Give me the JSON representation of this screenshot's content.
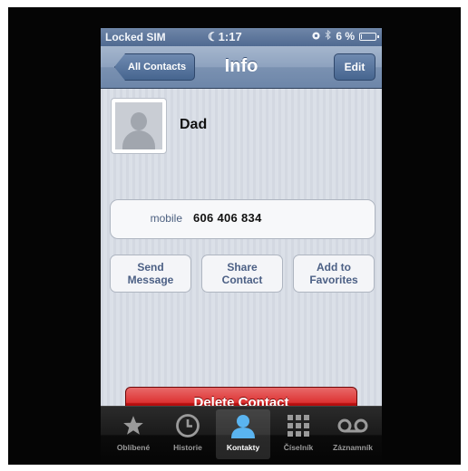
{
  "status_bar": {
    "carrier": "Locked SIM",
    "time": "1:17",
    "battery": "6 %",
    "battery_level": 0.06
  },
  "nav": {
    "back_label": "All Contacts",
    "title": "Info",
    "edit_label": "Edit"
  },
  "contact": {
    "name": "Dad",
    "phone_label": "mobile",
    "phone_number": "606 406 834"
  },
  "actions": {
    "send_line1": "Send",
    "send_line2": "Message",
    "share_line1": "Share",
    "share_line2": "Contact",
    "fav_line1": "Add to",
    "fav_line2": "Favorites",
    "delete_label": "Delete Contact"
  },
  "tabs": [
    {
      "label": "Oblíbené",
      "icon": "star-icon"
    },
    {
      "label": "Historie",
      "icon": "clock-icon"
    },
    {
      "label": "Kontakty",
      "icon": "contact-icon",
      "active": true
    },
    {
      "label": "Číselník",
      "icon": "keypad-icon"
    },
    {
      "label": "Záznamník",
      "icon": "voicemail-icon"
    }
  ],
  "colors": {
    "nav_blue": "#6d86a9",
    "delete_red": "#c21818",
    "tab_active_blue": "#5ab4f0"
  }
}
